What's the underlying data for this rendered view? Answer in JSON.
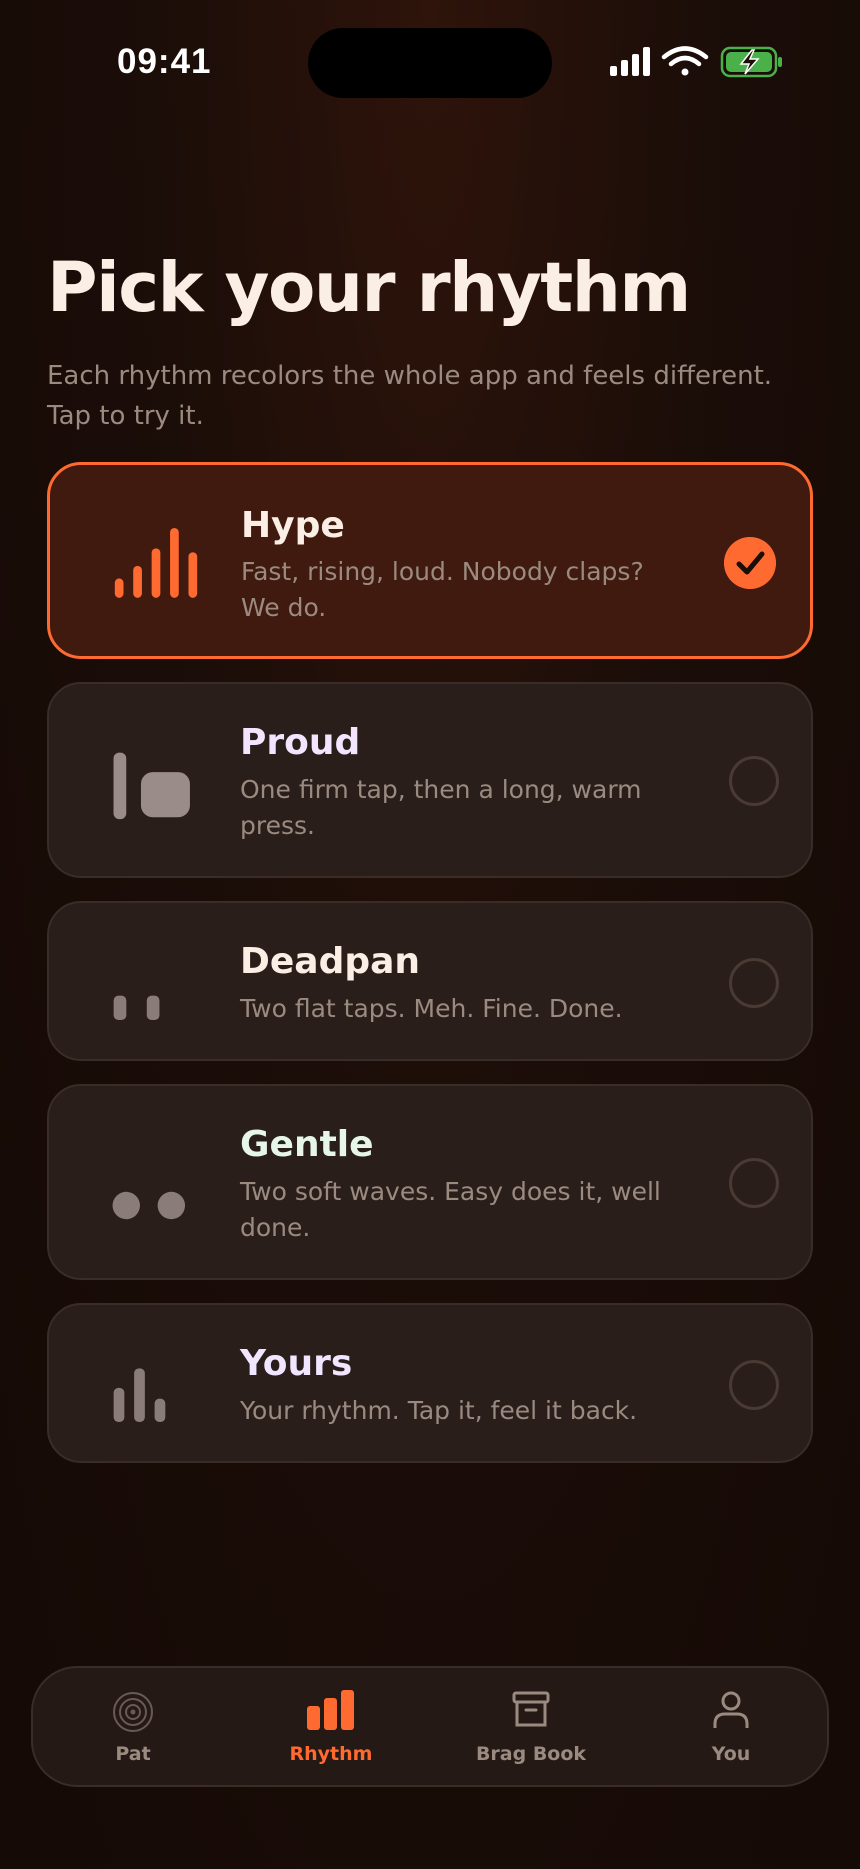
{
  "status_bar": {
    "time": "09:41"
  },
  "header": {
    "title": "Pick your rhythm",
    "subtitle": "Each rhythm recolors the whole app and feels different. Tap to try it."
  },
  "rhythms": [
    {
      "name": "Hype",
      "description": "Fast, rising, loud. Nobody claps? We do.",
      "selected": true,
      "name_color": "#fbeee4"
    },
    {
      "name": "Proud",
      "description": "One firm tap, then a long, warm press.",
      "selected": false,
      "name_color": "#f3e4ff"
    },
    {
      "name": "Deadpan",
      "description": "Two flat taps. Meh. Fine. Done.",
      "selected": false,
      "name_color": "#fbeee4"
    },
    {
      "name": "Gentle",
      "description": "Two soft waves. Easy does it, well done.",
      "selected": false,
      "name_color": "#e6f7e8"
    },
    {
      "name": "Yours",
      "description": "Your rhythm. Tap it, feel it back.",
      "selected": false,
      "name_color": "#f0e6ff"
    }
  ],
  "tab_bar": {
    "items": [
      {
        "label": "Pat",
        "icon": "target-icon",
        "active": false
      },
      {
        "label": "Rhythm",
        "icon": "bars-icon",
        "active": true
      },
      {
        "label": "Brag Book",
        "icon": "archive-icon",
        "active": false
      },
      {
        "label": "You",
        "icon": "person-icon",
        "active": false
      }
    ]
  },
  "colors": {
    "accent": "#ff6a30",
    "background": "#1b0d08",
    "card": "#2a1e1a",
    "selected_card": "#401a0e",
    "muted_text": "#9a8a80"
  }
}
